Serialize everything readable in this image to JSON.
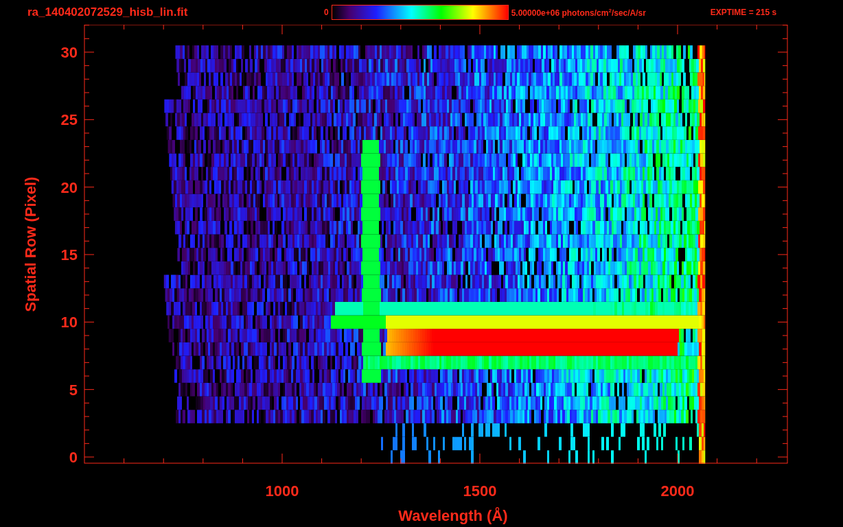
{
  "header": {
    "filename": "ra_140402072529_hisb_lin.fit",
    "colorbar": {
      "min_label": "0",
      "max_label": "5.00000e+06 photons/cm$^{2}$/sec/A/sr"
    },
    "exposure": "EXPTIME = 215 s"
  },
  "plot": {
    "x_axis": {
      "title": "Wavelength (Å)",
      "tick_labels": [
        "1000",
        "1500",
        "2000"
      ]
    },
    "y_axis": {
      "title": "Spatial Row (Pixel)",
      "tick_labels": [
        "30",
        "25",
        "20",
        "15",
        "10",
        "5",
        "0"
      ]
    }
  }
}
